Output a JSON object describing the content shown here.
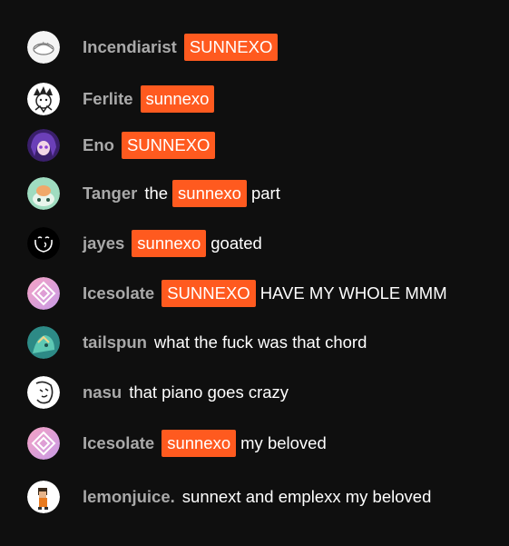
{
  "accent_color": "#ff5a1f",
  "messages": [
    {
      "author": "Incendiarist",
      "avatar_icon": "sleeping-figure-avatar-icon",
      "parts": [
        {
          "text": "SUNNEXO",
          "highlight": true
        }
      ]
    },
    {
      "author": "Ferlite",
      "avatar_icon": "manga-character-avatar-icon",
      "parts": [
        {
          "text": "sunnexo",
          "highlight": true
        }
      ]
    },
    {
      "author": "Eno",
      "avatar_icon": "purple-anime-avatar-icon",
      "parts": [
        {
          "text": "SUNNEXO",
          "highlight": true
        }
      ]
    },
    {
      "author": "Tanger",
      "avatar_icon": "green-creature-avatar-icon",
      "parts": [
        {
          "text": "the",
          "highlight": false
        },
        {
          "text": "sunnexo",
          "highlight": true
        },
        {
          "text": "part",
          "highlight": false
        }
      ]
    },
    {
      "author": "jayes",
      "avatar_icon": "smiley-sketch-avatar-icon",
      "parts": [
        {
          "text": "sunnexo",
          "highlight": true
        },
        {
          "text": "goated",
          "highlight": false
        }
      ]
    },
    {
      "author": "Icesolate",
      "avatar_icon": "pink-diamond-avatar-icon",
      "parts": [
        {
          "text": "SUNNEXO",
          "highlight": true
        },
        {
          "text": "HAVE MY WHOLE MMM",
          "highlight": false
        }
      ]
    },
    {
      "author": "tailspun",
      "avatar_icon": "teal-fox-avatar-icon",
      "parts": [
        {
          "text": "what the fuck was that chord",
          "highlight": false
        }
      ]
    },
    {
      "author": "nasu",
      "avatar_icon": "ink-face-avatar-icon",
      "parts": [
        {
          "text": "that piano goes crazy",
          "highlight": false
        }
      ]
    },
    {
      "author": "Icesolate",
      "avatar_icon": "pink-diamond-avatar-icon",
      "parts": [
        {
          "text": "sunnexo",
          "highlight": true
        },
        {
          "text": "my beloved",
          "highlight": false
        }
      ]
    },
    {
      "author": "lemonjuice.",
      "avatar_icon": "pixel-character-avatar-icon",
      "parts": [
        {
          "text": "sunnext and emplexx my beloved",
          "highlight": false
        }
      ]
    }
  ]
}
